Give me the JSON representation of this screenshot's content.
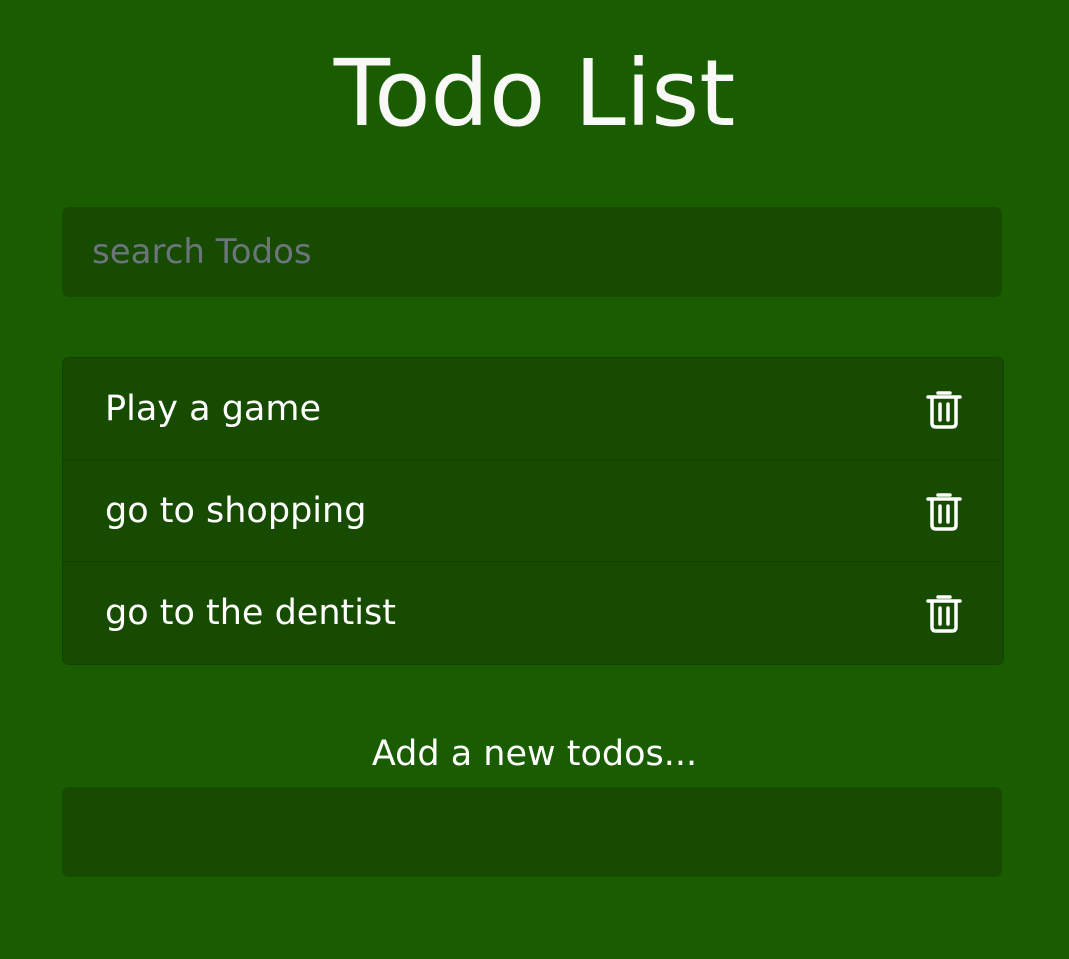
{
  "header": {
    "title": "Todo List"
  },
  "search": {
    "placeholder": "search Todos",
    "value": ""
  },
  "todos": [
    {
      "text": "Play a game",
      "icon": "trash-icon"
    },
    {
      "text": "go to shopping",
      "icon": "trash-icon"
    },
    {
      "text": "go to the dentist",
      "icon": "trash-icon"
    }
  ],
  "add_form": {
    "label": "Add a new todos...",
    "value": ""
  },
  "colors": {
    "background": "#1a5c00",
    "panel": "#164b00",
    "text": "#ffffff",
    "placeholder": "#6c757d"
  }
}
